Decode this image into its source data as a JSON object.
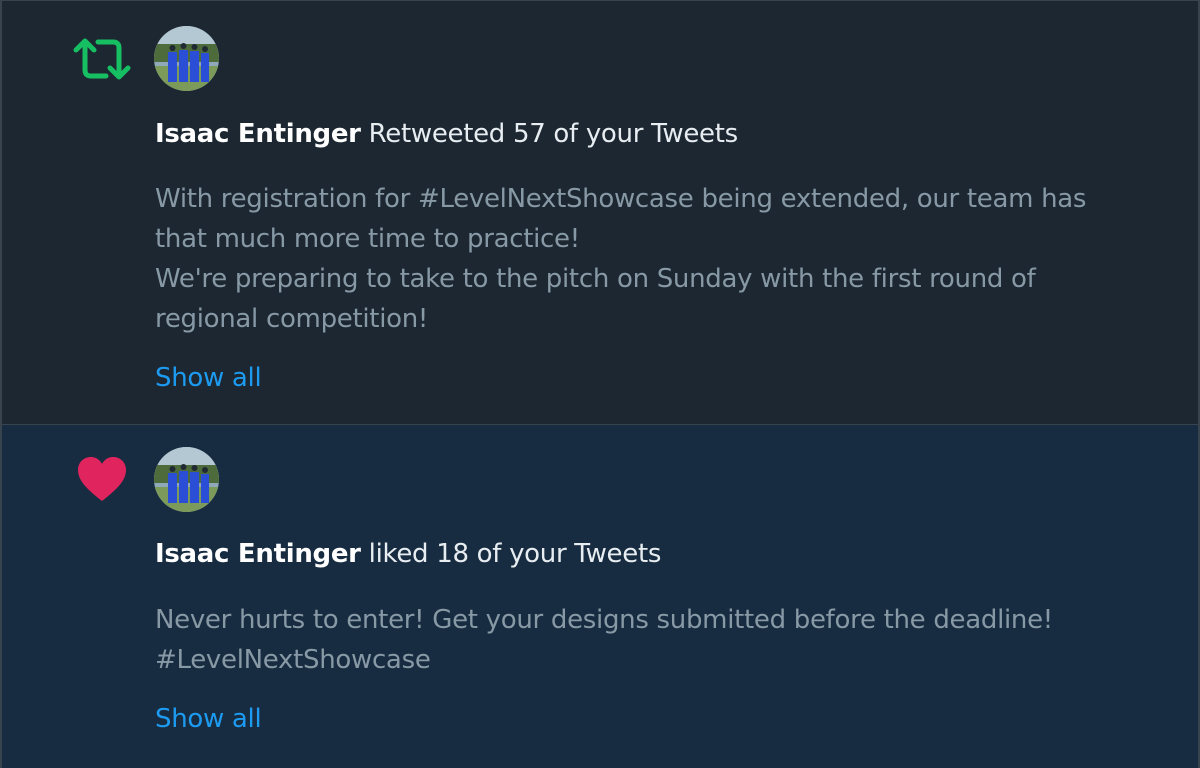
{
  "colors": {
    "retweet_icon": "#17bf63",
    "like_icon": "#e0245e",
    "link": "#1d9bf0",
    "name": "#ffffff",
    "body_text": "#8899a6"
  },
  "notifications": [
    {
      "type": "retweet",
      "icon": "retweet-icon",
      "user_name": "Isaac Entinger",
      "action_text": " Retweeted 57 of your Tweets",
      "body_lines": [
        "With registration for #LevelNextShowcase being extended, our team has",
        "that much more time to practice!",
        "We're preparing to take to the pitch on Sunday with the first round of",
        "regional competition!"
      ],
      "show_all_label": "Show all"
    },
    {
      "type": "like",
      "icon": "heart-icon",
      "user_name": "Isaac Entinger",
      "action_text": " liked 18 of your Tweets",
      "body_lines": [
        "Never hurts to enter! Get your designs submitted before the deadline!",
        "#LevelNextShowcase"
      ],
      "show_all_label": "Show all"
    }
  ]
}
